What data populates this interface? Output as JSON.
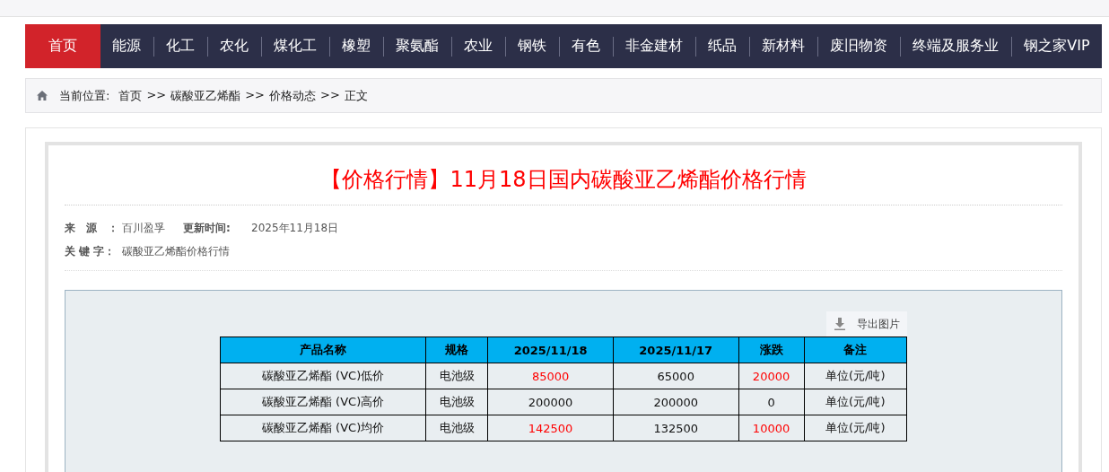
{
  "nav": {
    "items": [
      {
        "label": "首页",
        "selected": true
      },
      {
        "label": "能源",
        "selected": false
      },
      {
        "label": "化工",
        "selected": false
      },
      {
        "label": "农化",
        "selected": false
      },
      {
        "label": "煤化工",
        "selected": false
      },
      {
        "label": "橡塑",
        "selected": false
      },
      {
        "label": "聚氨酯",
        "selected": false
      },
      {
        "label": "农业",
        "selected": false
      },
      {
        "label": "钢铁",
        "selected": false
      },
      {
        "label": "有色",
        "selected": false
      },
      {
        "label": "非金建材",
        "selected": false
      },
      {
        "label": "纸品",
        "selected": false
      },
      {
        "label": "新材料",
        "selected": false
      },
      {
        "label": "废旧物资",
        "selected": false
      },
      {
        "label": "终端及服务业",
        "selected": false
      },
      {
        "label": "钢之家VIP",
        "selected": false
      }
    ]
  },
  "breadcrumb": {
    "label": "当前位置:",
    "items": [
      "首页",
      "碳酸亚乙烯酯",
      "价格动态",
      "正文"
    ],
    "separator": ">>"
  },
  "article": {
    "title": "【价格行情】11月18日国内碳酸亚乙烯酯价格行情",
    "meta": [
      {
        "label": "来　源　：",
        "value": "百川盈孚",
        "label_2": "更新时间:",
        "value_2": "2025年11月18日"
      },
      {
        "label": "关 键 字：",
        "value": "碳酸亚乙烯酯价格行情"
      }
    ],
    "export_button": "导出图片",
    "table": {
      "columns": [
        "产品名称",
        "规格",
        "2025/11/18",
        "2025/11/17",
        "涨跌",
        "备注"
      ],
      "rows": [
        {
          "cells": [
            "碳酸亚乙烯酯 (VC)低价",
            "电池级",
            "85000",
            "65000",
            "20000",
            "单位(元/吨)"
          ],
          "rising": true
        },
        {
          "cells": [
            "碳酸亚乙烯酯 (VC)高价",
            "电池级",
            "200000",
            "200000",
            "0",
            "单位(元/吨)"
          ],
          "rising": false
        },
        {
          "cells": [
            "碳酸亚乙烯酯 (VC)均价",
            "电池级",
            "142500",
            "132500",
            "10000",
            "单位(元/吨)"
          ],
          "rising": true
        }
      ]
    }
  }
}
